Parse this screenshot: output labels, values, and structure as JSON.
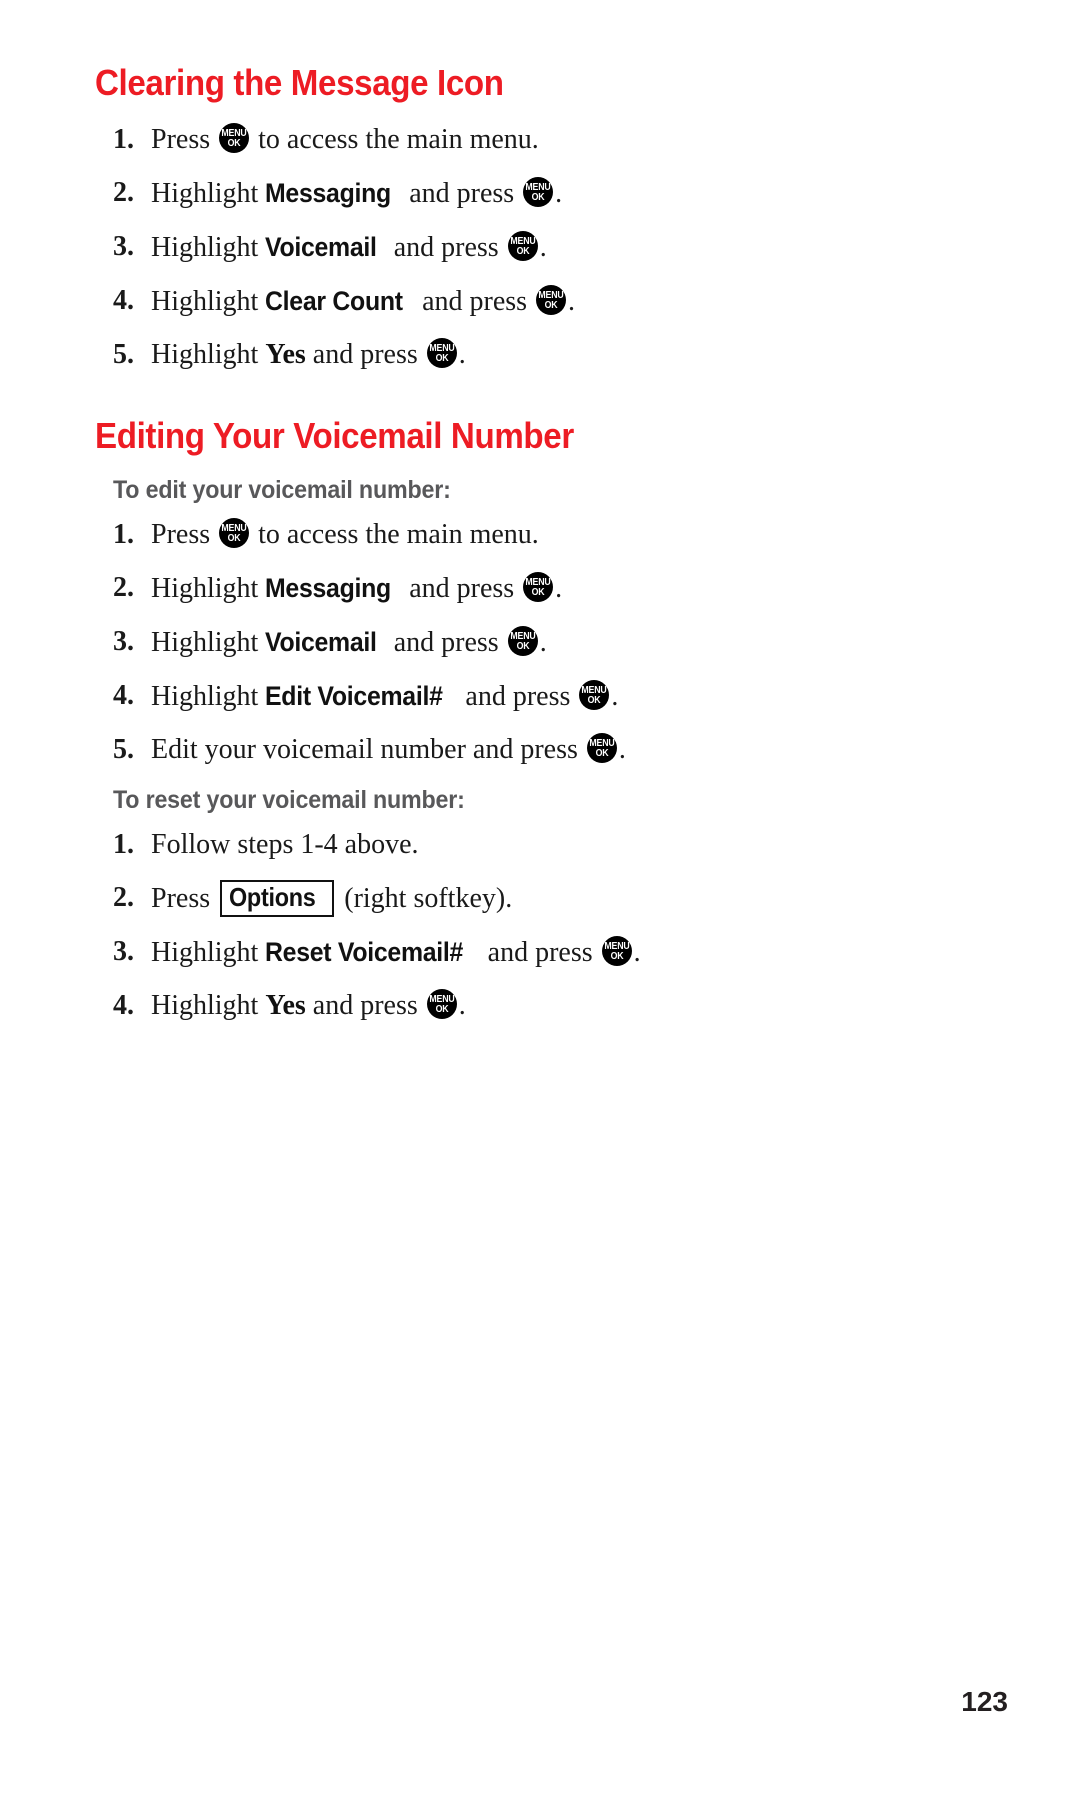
{
  "document": {
    "page_number": "123",
    "heading_color": "#ed1c24",
    "subheading_color": "#58585a",
    "body_color": "#1a1a1a"
  },
  "icons": {
    "menu_key": {
      "line1": "MENU",
      "line2": "OK",
      "name": "menu-ok-key-icon"
    }
  },
  "sections": [
    {
      "heading": "Clearing the Message Icon",
      "steps": [
        {
          "num": "1.",
          "parts": [
            {
              "type": "text",
              "value": "Press "
            },
            {
              "type": "menukey"
            },
            {
              "type": "text",
              "value": " to access the main menu."
            }
          ]
        },
        {
          "num": "2.",
          "parts": [
            {
              "type": "text",
              "value": "Highlight "
            },
            {
              "type": "menu-term",
              "value": "Messaging"
            },
            {
              "type": "text",
              "value": " and press "
            },
            {
              "type": "menukey"
            },
            {
              "type": "text",
              "value": "."
            }
          ]
        },
        {
          "num": "3.",
          "parts": [
            {
              "type": "text",
              "value": "Highlight "
            },
            {
              "type": "menu-term",
              "value": "Voicemail"
            },
            {
              "type": "text",
              "value": " and press "
            },
            {
              "type": "menukey"
            },
            {
              "type": "text",
              "value": "."
            }
          ]
        },
        {
          "num": "4.",
          "parts": [
            {
              "type": "text",
              "value": "Highlight "
            },
            {
              "type": "menu-term",
              "value": "Clear Count"
            },
            {
              "type": "text",
              "value": " and press "
            },
            {
              "type": "menukey"
            },
            {
              "type": "text",
              "value": "."
            }
          ]
        },
        {
          "num": "5.",
          "parts": [
            {
              "type": "text",
              "value": "Highlight "
            },
            {
              "type": "serif-term",
              "value": "Yes"
            },
            {
              "type": "text",
              "value": " and press "
            },
            {
              "type": "menukey"
            },
            {
              "type": "text",
              "value": "."
            }
          ]
        }
      ]
    },
    {
      "heading": "Editing Your Voicemail Number",
      "subsections": [
        {
          "subheading": "To edit your voicemail number:",
          "steps": [
            {
              "num": "1.",
              "parts": [
                {
                  "type": "text",
                  "value": "Press "
                },
                {
                  "type": "menukey"
                },
                {
                  "type": "text",
                  "value": " to access the main menu."
                }
              ]
            },
            {
              "num": "2.",
              "parts": [
                {
                  "type": "text",
                  "value": "Highlight "
                },
                {
                  "type": "menu-term",
                  "value": "Messaging"
                },
                {
                  "type": "text",
                  "value": " and press "
                },
                {
                  "type": "menukey"
                },
                {
                  "type": "text",
                  "value": "."
                }
              ]
            },
            {
              "num": "3.",
              "parts": [
                {
                  "type": "text",
                  "value": "Highlight "
                },
                {
                  "type": "menu-term",
                  "value": "Voicemail"
                },
                {
                  "type": "text",
                  "value": " and press "
                },
                {
                  "type": "menukey"
                },
                {
                  "type": "text",
                  "value": "."
                }
              ]
            },
            {
              "num": "4.",
              "parts": [
                {
                  "type": "text",
                  "value": "Highlight "
                },
                {
                  "type": "menu-term",
                  "value": "Edit Voicemail#"
                },
                {
                  "type": "text",
                  "value": " and press "
                },
                {
                  "type": "menukey"
                },
                {
                  "type": "text",
                  "value": "."
                }
              ]
            },
            {
              "num": "5.",
              "parts": [
                {
                  "type": "text",
                  "value": "Edit your voicemail number and press "
                },
                {
                  "type": "menukey"
                },
                {
                  "type": "text",
                  "value": "."
                }
              ]
            }
          ]
        },
        {
          "subheading": "To reset your voicemail number:",
          "steps": [
            {
              "num": "1.",
              "parts": [
                {
                  "type": "text",
                  "value": "Follow steps 1-4 above."
                }
              ]
            },
            {
              "num": "2.",
              "parts": [
                {
                  "type": "text",
                  "value": "Press "
                },
                {
                  "type": "softkey",
                  "value": "Options"
                },
                {
                  "type": "text",
                  "value": " (right softkey)."
                }
              ]
            },
            {
              "num": "3.",
              "parts": [
                {
                  "type": "text",
                  "value": "Highlight "
                },
                {
                  "type": "menu-term",
                  "value": "Reset Voicemail#"
                },
                {
                  "type": "text",
                  "value": " and press "
                },
                {
                  "type": "menukey"
                },
                {
                  "type": "text",
                  "value": "."
                }
              ]
            },
            {
              "num": "4.",
              "parts": [
                {
                  "type": "text",
                  "value": "Highlight "
                },
                {
                  "type": "serif-term",
                  "value": "Yes"
                },
                {
                  "type": "text",
                  "value": " and press "
                },
                {
                  "type": "menukey"
                },
                {
                  "type": "text",
                  "value": "."
                }
              ]
            }
          ]
        }
      ]
    }
  ]
}
